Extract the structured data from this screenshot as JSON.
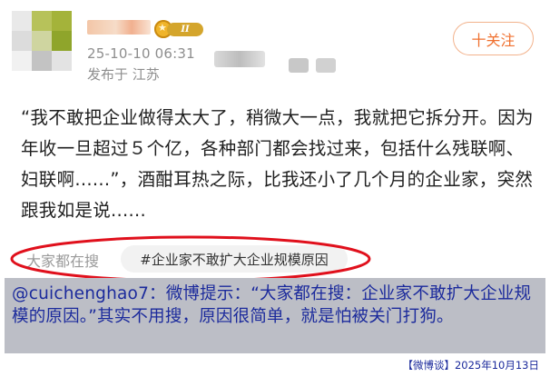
{
  "author": {
    "level_badge": "II",
    "time": "25-10-10 06:31",
    "location": "发布于 江苏"
  },
  "follow_button": {
    "label": "十关注"
  },
  "post": {
    "text": "“我不敢把企业做得太大了，稍微大一点，我就把它拆分开。因为年收一旦超过５个亿，各种部门都会找过来，包括什么残联啊、妇联啊......”，酒酣耳热之际，比我还小了几个月的企业家，突然跟我如是说......"
  },
  "search_suggest": {
    "label": "大家都在搜",
    "topic": "#企业家不敢扩大企业规模原因"
  },
  "annotation": {
    "text": "@cuichenghao7：微博提示：“大家都在搜：企业家不敢扩大企业规模的原因。”其实不用搜，原因很简单，就是怕被关门打狗。",
    "source": "【微博谈】2025年10月13日"
  },
  "colors": {
    "accent_orange": "#f0702f",
    "highlight_ellipse": "#e0101c",
    "annotation_text": "#1b2a9c",
    "annotation_bg": "#bcbec6"
  }
}
